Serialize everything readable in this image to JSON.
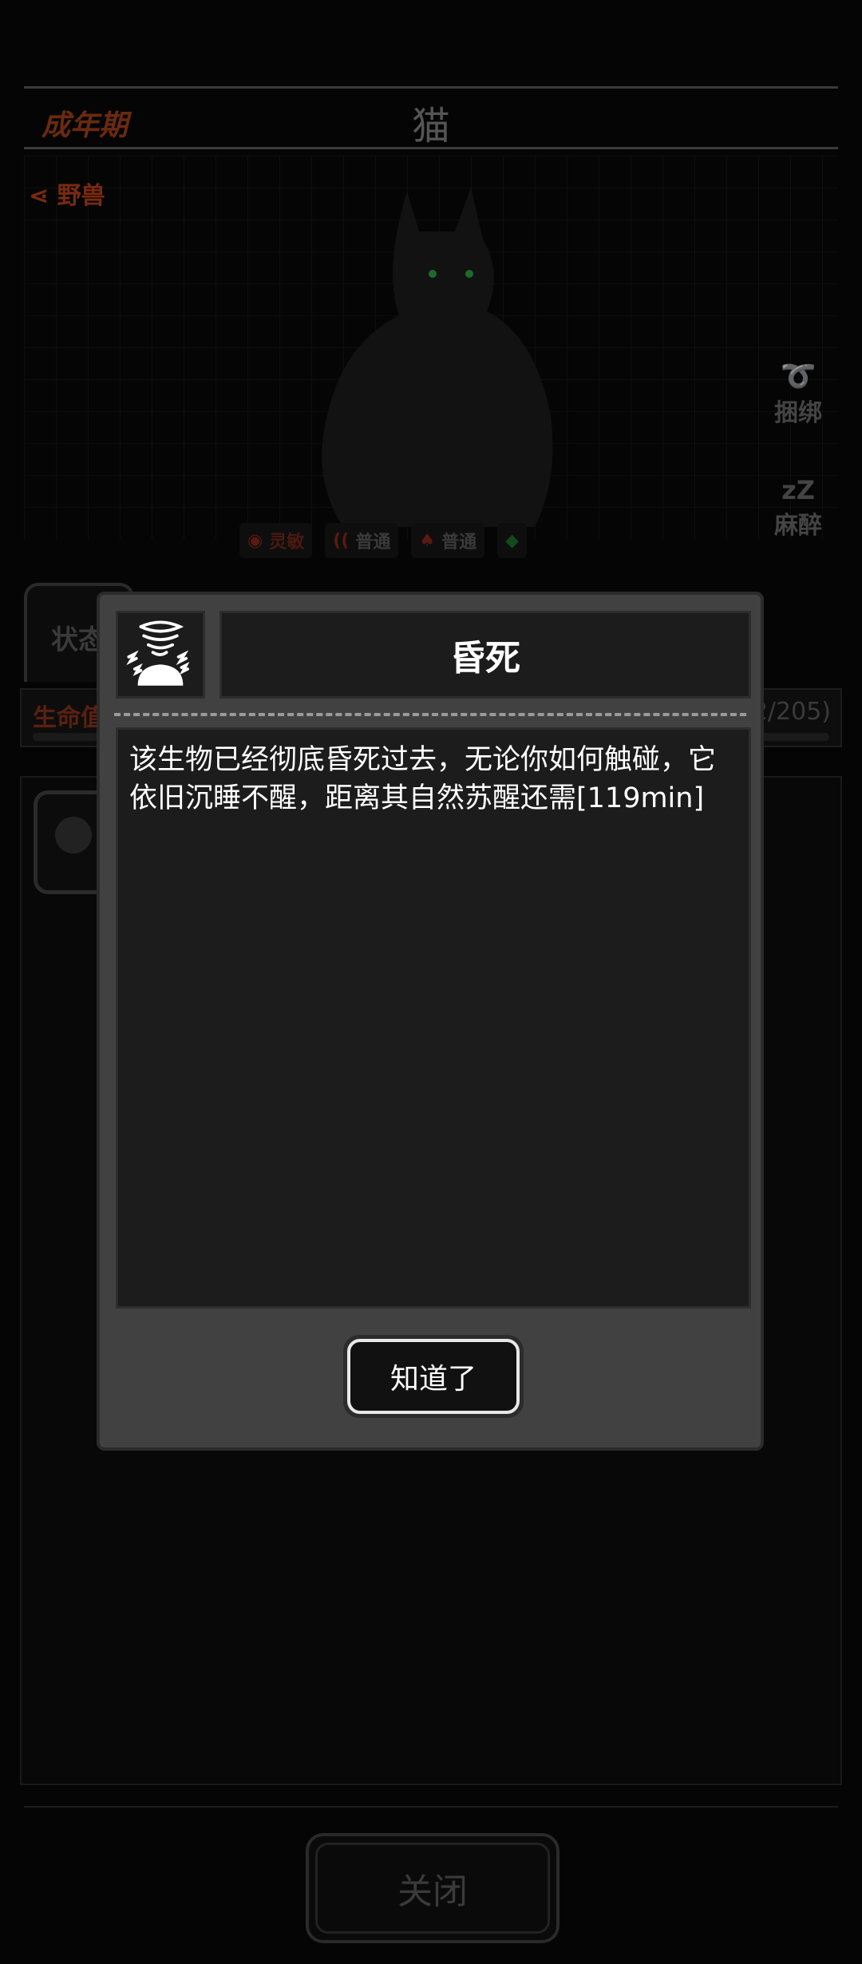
{
  "background": {
    "stage_label": "成年期",
    "creature_name": "猫",
    "creature_type": "野兽",
    "actions": [
      {
        "label": "捆绑",
        "icon": "rope-icon"
      },
      {
        "label": "麻醉",
        "icon": "sleep-zz-icon"
      }
    ],
    "senses": [
      {
        "icon": "eye-icon",
        "label": "灵敏",
        "color": "#5a1a10"
      },
      {
        "icon": "ear-icon",
        "label": "普通",
        "color": "#4a1a10"
      },
      {
        "icon": "nose-icon",
        "label": "普通",
        "color": "#4a1a10"
      },
      {
        "icon": "question-icon",
        "label": "",
        "color": "#124a1a"
      }
    ],
    "status_tab": "状态",
    "hp_label": "生命值",
    "hp_value": "2/205)",
    "close_button": "关闭"
  },
  "modal": {
    "icon": "stun-tornado-icon",
    "title": "昏死",
    "description": "该生物已经彻底昏死过去，无论你如何触碰，它依旧沉睡不醒，距离其自然苏醒还需[119min]",
    "confirm_button": "知道了"
  },
  "colors": {
    "modal_bg": "#414141",
    "panel_bg": "#1c1c1c",
    "text": "#ffffff"
  }
}
